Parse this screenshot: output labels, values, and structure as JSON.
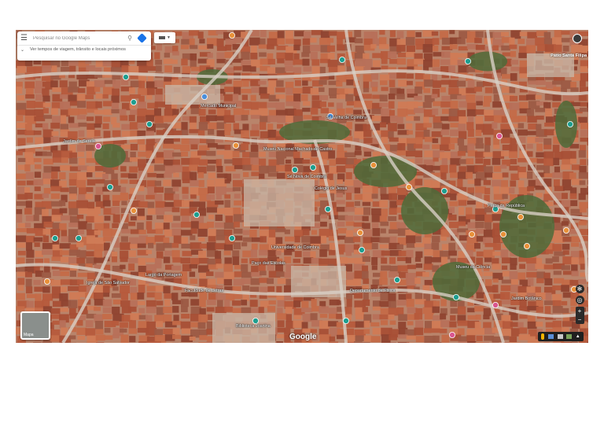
{
  "search": {
    "placeholder": "Pesquisar no Google Maps",
    "suggestion": "Ver tempos de viagem, trânsito e locais próximos"
  },
  "corner_label": "Pátio Santa Filipa",
  "layer_thumb_label": "Mapa",
  "google_logo": "Google",
  "map_labels": [
    {
      "text": "Museu Nacional Machado de Castro"
    },
    {
      "text": "Sé Nova de Coimbra"
    },
    {
      "text": "Universidade de Coimbra"
    },
    {
      "text": "Paço das Escolas"
    },
    {
      "text": "Biblioteca Joanina"
    },
    {
      "text": "Mercado Municipal"
    },
    {
      "text": "Jardim da Sereia"
    },
    {
      "text": "Praça da República"
    },
    {
      "text": "Sé Velha de Coimbra"
    },
    {
      "text": "Departamento de Física"
    },
    {
      "text": "Igreja de São Salvador"
    },
    {
      "text": "Largo da Portagem"
    },
    {
      "text": "Faculdade de Letras"
    },
    {
      "text": "Museu da Ciência"
    },
    {
      "text": "Colégio de Jesus"
    },
    {
      "text": "Jardim Botânico"
    }
  ],
  "pin_colors": {
    "teal": "#1e9e8f",
    "orange": "#e8913a",
    "blue": "#4a8fdb",
    "pink": "#d9568f"
  },
  "colors": {
    "roof": "#b65a3c",
    "roof_dark": "#8f4330",
    "greenery": "#4d6b3a",
    "road": "#d8cfc6",
    "plaza": "#c9b8a8"
  }
}
